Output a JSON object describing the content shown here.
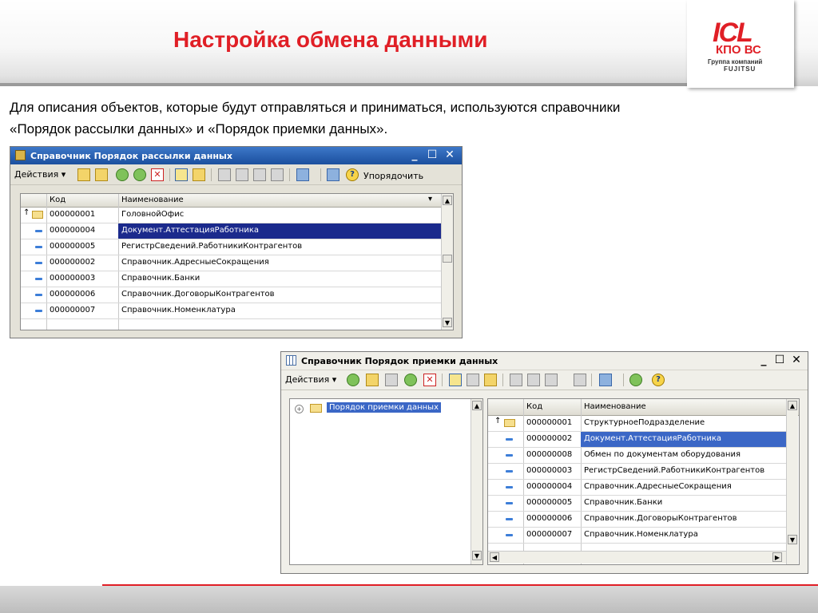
{
  "slide": {
    "title": "Настройка обмена данными",
    "intro_line1": "Для описания объектов, которые будут отправляться и приниматься, используются справочники",
    "intro_line2": "«Порядок рассылки данных» и «Порядок приемки данных».",
    "logo": {
      "mark": "ICL",
      "line2": "КПО ВС",
      "line3": "Группа компаний",
      "line4": "FUJITSU"
    },
    "colors": {
      "title": "#e01f26",
      "selection_dark": "#1b2a8c",
      "selection_light": "#3b67c6",
      "row_marker": "#3d7ed8"
    }
  },
  "window1": {
    "title": "Справочник Порядок рассылки данных",
    "controls": {
      "minimize": "_",
      "maximize": "☐",
      "close": "✕"
    },
    "toolbar": {
      "actions": "Действия ▾",
      "order": "Упорядочить"
    },
    "columns": {
      "code": "Код",
      "name": "Наименование"
    },
    "rows": [
      {
        "code": "000000001",
        "name": "ГоловнойОфис"
      },
      {
        "code": "000000004",
        "name": "Документ.АттестацияРаботника"
      },
      {
        "code": "000000005",
        "name": "РегистрСведений.РаботникиКонтрагентов"
      },
      {
        "code": "000000002",
        "name": "Справочник.АдресныеСокращения"
      },
      {
        "code": "000000003",
        "name": "Справочник.Банки"
      },
      {
        "code": "000000006",
        "name": "Справочник.ДоговорыКонтрагентов"
      },
      {
        "code": "000000007",
        "name": "Справочник.Номенклатура"
      }
    ]
  },
  "window2": {
    "title": "Справочник Порядок приемки данных",
    "controls": {
      "minimize": "_",
      "maximize": "☐",
      "close": "✕"
    },
    "toolbar": {
      "actions": "Действия ▾"
    },
    "tree": {
      "root": "Порядок приемки данных"
    },
    "columns": {
      "code": "Код",
      "name": "Наименование"
    },
    "rows": [
      {
        "code": "000000001",
        "name": "СтруктурноеПодразделение"
      },
      {
        "code": "000000002",
        "name": "Документ.АттестацияРаботника"
      },
      {
        "code": "000000008",
        "name": "Обмен по документам оборудования"
      },
      {
        "code": "000000003",
        "name": "РегистрСведений.РаботникиКонтрагентов"
      },
      {
        "code": "000000004",
        "name": "Справочник.АдресныеСокращения"
      },
      {
        "code": "000000005",
        "name": "Справочник.Банки"
      },
      {
        "code": "000000006",
        "name": "Справочник.ДоговорыКонтрагентов"
      },
      {
        "code": "000000007",
        "name": "Справочник.Номенклатура"
      }
    ]
  }
}
